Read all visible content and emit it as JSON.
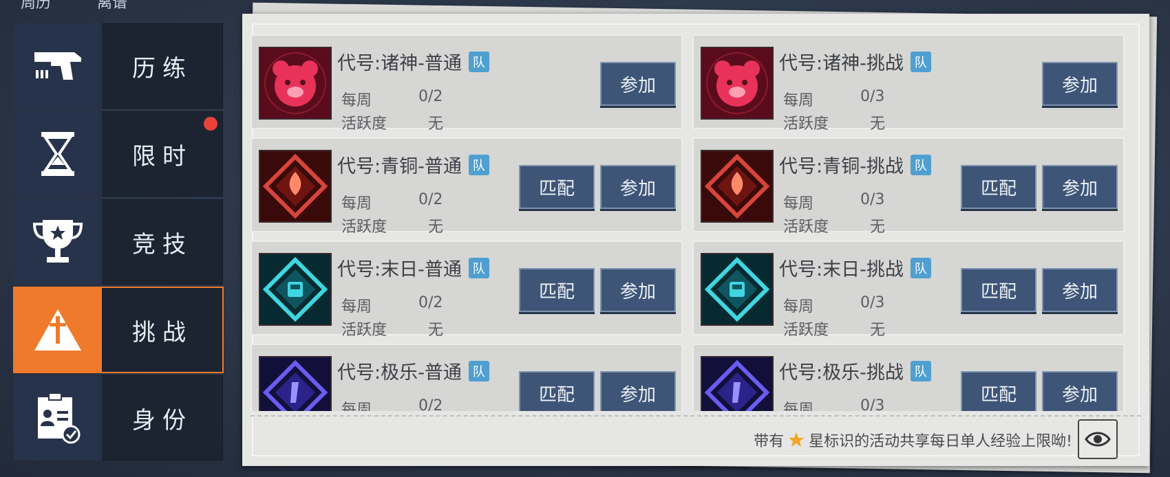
{
  "top_tabs": [
    "周历",
    "离谱"
  ],
  "sidebar": {
    "items": [
      {
        "label": "历练",
        "icon": "gun-icon",
        "active": false,
        "badge": false
      },
      {
        "label": "限时",
        "icon": "hourglass-icon",
        "active": false,
        "badge": true
      },
      {
        "label": "竞技",
        "icon": "trophy-icon",
        "active": false,
        "badge": false
      },
      {
        "label": "挑战",
        "icon": "sword-triangle-icon",
        "active": true,
        "badge": false
      },
      {
        "label": "身份",
        "icon": "id-badge-icon",
        "active": false,
        "badge": false
      }
    ]
  },
  "labels": {
    "weekly": "每周",
    "activity": "活跃度",
    "match": "匹配",
    "join": "参加",
    "team": "队"
  },
  "events": [
    {
      "title": "代号:诸神-普通",
      "weekly": "0/2",
      "activity": "无",
      "has_match": false,
      "theme": "pink-bear",
      "color": "#e8325a"
    },
    {
      "title": "代号:诸神-挑战",
      "weekly": "0/3",
      "activity": "无",
      "has_match": false,
      "theme": "pink-bear",
      "color": "#e8325a"
    },
    {
      "title": "代号:青铜-普通",
      "weekly": "0/2",
      "activity": "无",
      "has_match": true,
      "theme": "red-flame",
      "color": "#d8453a"
    },
    {
      "title": "代号:青铜-挑战",
      "weekly": "0/3",
      "activity": "无",
      "has_match": true,
      "theme": "red-flame",
      "color": "#d8453a"
    },
    {
      "title": "代号:末日-普通",
      "weekly": "0/2",
      "activity": "无",
      "has_match": true,
      "theme": "cyan-train",
      "color": "#3fd6e0"
    },
    {
      "title": "代号:末日-挑战",
      "weekly": "0/3",
      "activity": "无",
      "has_match": true,
      "theme": "cyan-train",
      "color": "#3fd6e0"
    },
    {
      "title": "代号:极乐-普通",
      "weekly": "0/2",
      "activity": "",
      "has_match": true,
      "theme": "purple-crystal",
      "color": "#6a5cf0"
    },
    {
      "title": "代号:极乐-挑战",
      "weekly": "0/3",
      "activity": "",
      "has_match": true,
      "theme": "purple-crystal",
      "color": "#6a5cf0"
    }
  ],
  "footer": {
    "prefix": "带有",
    "suffix": "星标识的活动共享每日单人经验上限呦!",
    "star_icon": "star-icon",
    "eye_icon": "eye-icon"
  }
}
